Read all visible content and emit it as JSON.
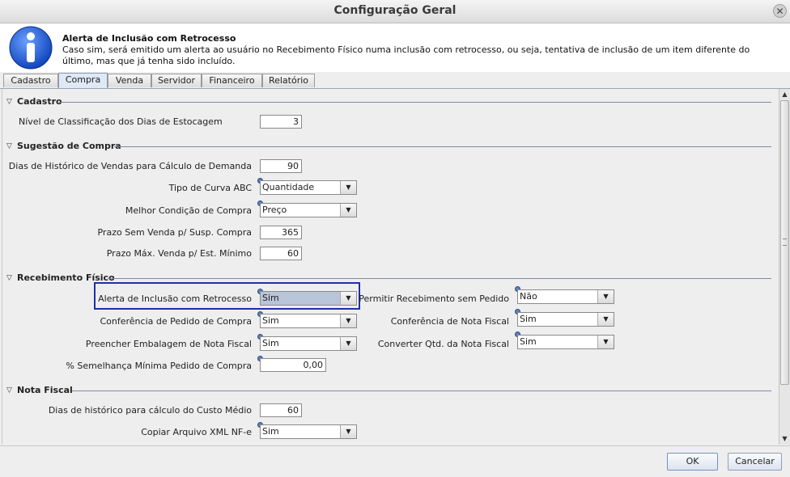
{
  "window": {
    "title": "Configuração Geral"
  },
  "info": {
    "heading": "Alerta de Inclusão com Retrocesso",
    "description": "Caso sim, será emitido um alerta ao usuário no Recebimento Físico numa inclusão com retrocesso, ou seja, tentativa de inclusão de um item diferente do último, mas que já tenha sido incluído."
  },
  "tabs": [
    "Cadastro",
    "Compra",
    "Venda",
    "Servidor",
    "Financeiro",
    "Relatório"
  ],
  "active_tab": "Compra",
  "sections": {
    "cadastro": {
      "title": "Cadastro",
      "nivel_label": "Nível de Classificação dos Dias de Estocagem",
      "nivel_value": "3"
    },
    "sugestao": {
      "title": "Sugestão de Compra",
      "dias_hist_label": "Dias de Histórico de Vendas para Cálculo de Demanda",
      "dias_hist_value": "90",
      "curva_label": "Tipo de Curva ABC",
      "curva_value": "Quantidade",
      "melhor_label": "Melhor Condição de Compra",
      "melhor_value": "Preço",
      "prazo_sem_label": "Prazo Sem Venda p/ Susp. Compra",
      "prazo_sem_value": "365",
      "prazo_max_label": "Prazo Máx. Venda p/ Est. Mínimo",
      "prazo_max_value": "60"
    },
    "recebimento": {
      "title": "Recebimento Físico",
      "alerta_label": "Alerta de Inclusão com Retrocesso",
      "alerta_value": "Sim",
      "conf_pedido_label": "Conferência de Pedido de Compra",
      "conf_pedido_value": "Sim",
      "embalagem_label": "Preencher Embalagem de Nota Fiscal",
      "embalagem_value": "Sim",
      "semelhanca_label": "% Semelhança Mínima Pedido de Compra",
      "semelhanca_value": "0,00",
      "permitir_label": "Permitir Recebimento sem Pedido",
      "permitir_value": "Não",
      "conf_nota_label": "Conferência de Nota Fiscal",
      "conf_nota_value": "Sim",
      "converter_label": "Converter Qtd. da Nota Fiscal",
      "converter_value": "Sim"
    },
    "nota": {
      "title": "Nota Fiscal",
      "dias_custo_label": "Dias de histórico para cálculo do Custo Médio",
      "dias_custo_value": "60",
      "xml_label": "Copiar Arquivo XML NF-e",
      "xml_value": "Sim"
    }
  },
  "buttons": {
    "ok": "OK",
    "cancel": "Cancelar"
  },
  "icons": {
    "close": "close-icon",
    "info": "info-icon",
    "dropdown": "chevron-down-icon",
    "collapse": "triangle-down-icon"
  }
}
